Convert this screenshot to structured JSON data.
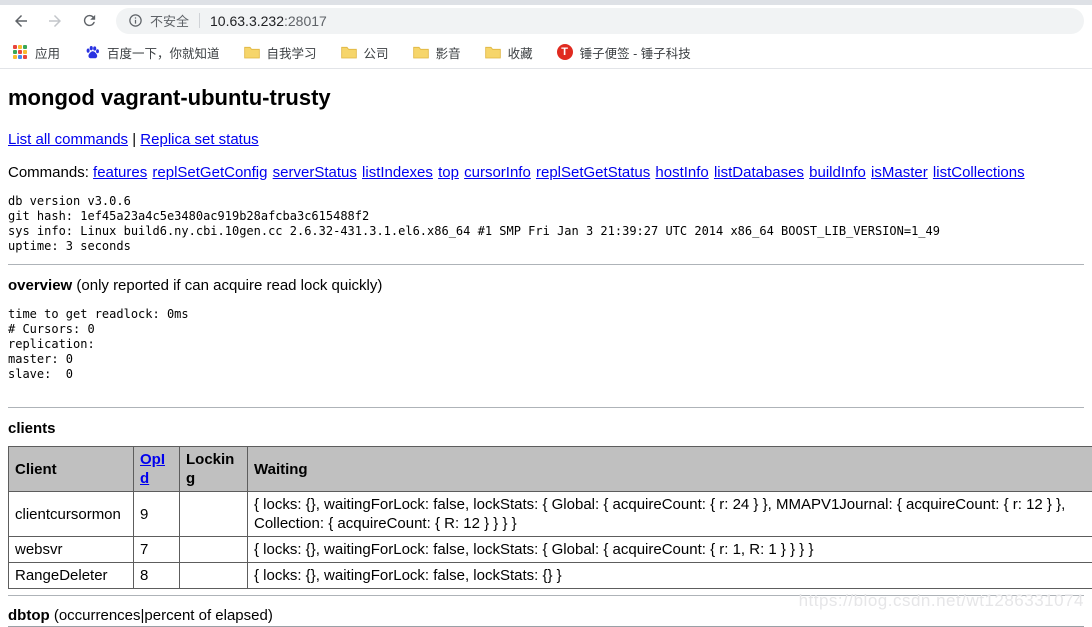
{
  "browser": {
    "security_label": "不安全",
    "url": {
      "host": "10.63.3.232",
      "port": ":28017"
    },
    "bookmarks": [
      {
        "label": "应用",
        "icon": "apps-grid-icon"
      },
      {
        "label": "百度一下，你就知道",
        "icon": "baidu-icon"
      },
      {
        "label": "自我学习",
        "icon": "folder-icon"
      },
      {
        "label": "公司",
        "icon": "folder-icon"
      },
      {
        "label": "影音",
        "icon": "folder-icon"
      },
      {
        "label": "收藏",
        "icon": "folder-icon"
      },
      {
        "label": "锤子便签 - 锤子科技",
        "icon": "smartisan-t-icon"
      }
    ]
  },
  "page": {
    "title": "mongod vagrant-ubuntu-trusty",
    "top_links": {
      "list_all_commands": "List all commands",
      "separator": "|",
      "replica_set_status": "Replica set status"
    },
    "commands_label": "Commands:",
    "commands": [
      "features",
      "replSetGetConfig",
      "serverStatus",
      "listIndexes",
      "top",
      "cursorInfo",
      "replSetGetStatus",
      "hostInfo",
      "listDatabases",
      "buildInfo",
      "isMaster",
      "listCollections"
    ],
    "build_info": "db version v3.0.6\ngit hash: 1ef45a23a4c5e3480ac919b28afcba3c615488f2\nsys info: Linux build6.ny.cbi.10gen.cc 2.6.32-431.3.1.el6.x86_64 #1 SMP Fri Jan 3 21:39:27 UTC 2014 x86_64 BOOST_LIB_VERSION=1_49\nuptime: 3 seconds",
    "overview": {
      "title": "overview",
      "subtitle": " (only reported if can acquire read lock quickly)",
      "stats": "time to get readlock: 0ms\n# Cursors: 0\nreplication: \nmaster: 0\nslave:  0"
    },
    "clients": {
      "title": "clients",
      "columns": {
        "client": "Client",
        "opid": "OpId",
        "locking": "Locking",
        "waiting": "Waiting"
      },
      "rows": [
        {
          "client": "clientcursormon",
          "opid": "9",
          "locking": "",
          "waiting": "{ locks: {}, waitingForLock: false, lockStats: { Global: { acquireCount: { r: 24 } }, MMAPV1Journal: { acquireCount: { r: 12 } }, Collection: { acquireCount: { R: 12 } } } }"
        },
        {
          "client": "websvr",
          "opid": "7",
          "locking": "",
          "waiting": "{ locks: {}, waitingForLock: false, lockStats: { Global: { acquireCount: { r: 1, R: 1 } } } }"
        },
        {
          "client": "RangeDeleter",
          "opid": "8",
          "locking": "",
          "waiting": "{ locks: {}, waitingForLock: false, lockStats: {} }"
        }
      ]
    },
    "dbtop": {
      "title": "dbtop",
      "subtitle": " (occurrences|percent of elapsed)"
    }
  },
  "watermark": "https://blog.csdn.net/wt1286331074",
  "colors": {
    "link": "#0000ee",
    "table_header_bg": "#c0c0c0",
    "address_pill_bg": "#f1f3f4",
    "toolbar_icon": "#5f6368"
  }
}
